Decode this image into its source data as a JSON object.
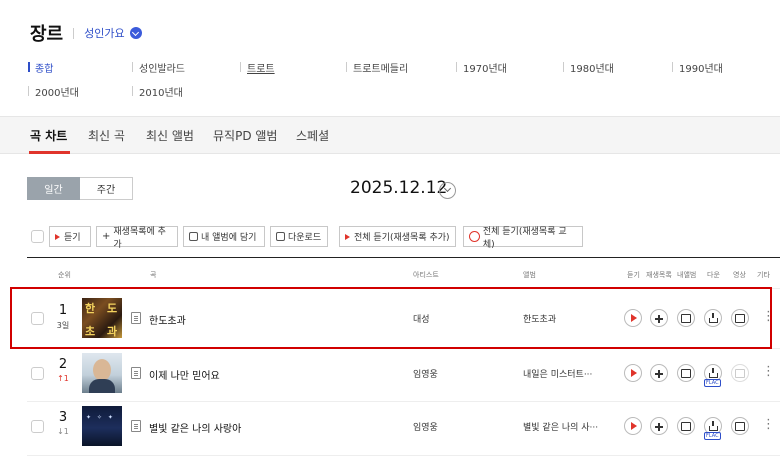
{
  "header": {
    "title": "장르",
    "subgenre": "성인가요"
  },
  "categories": [
    {
      "label": "종합",
      "active": true
    },
    {
      "label": "성인발라드"
    },
    {
      "label": "트로트"
    },
    {
      "label": "트로트메들리"
    },
    {
      "label": "1970년대"
    },
    {
      "label": "1980년대"
    },
    {
      "label": "1990년대"
    },
    {
      "label": "2000년대"
    },
    {
      "label": "2010년대"
    }
  ],
  "tabs": [
    {
      "label": "곡 차트",
      "active": true
    },
    {
      "label": "최신 곡"
    },
    {
      "label": "최신 앨범"
    },
    {
      "label": "뮤직PD 앨범"
    },
    {
      "label": "스페셜"
    }
  ],
  "period": {
    "daily": "일간",
    "weekly": "주간"
  },
  "date": "2025.12.12",
  "actions": {
    "listen": "듣기",
    "add_playlist": "재생목록에 추가",
    "add_my_album": "내 앨범에 담기",
    "download": "다운로드",
    "listen_all_add": "전체 듣기(재생목록 추가)",
    "listen_all_replace": "전체 듣기(재생목록 교체)"
  },
  "columns": {
    "rank": "순위",
    "song": "곡",
    "artist": "아티스트",
    "album": "앨범",
    "listen": "듣기",
    "playlist": "재생목록",
    "my_album": "내앨범",
    "download": "다운",
    "video": "영상",
    "etc": "기타"
  },
  "rows": [
    {
      "rank": "1",
      "change": "3일",
      "title": "한도초과",
      "artist": "대성",
      "album": "한도초과",
      "flac": false,
      "video": true
    },
    {
      "rank": "2",
      "change": "↑1",
      "title": "이제 나만 믿어요",
      "artist": "임영웅",
      "album": "내일은 미스터트···",
      "flac": true,
      "video": false
    },
    {
      "rank": "3",
      "change": "↓1",
      "title": "별빛 같은 나의 사랑아",
      "artist": "임영웅",
      "album": "별빛 같은 나의 사···",
      "flac": true,
      "video": true
    }
  ],
  "icons": [
    "check-circle-icon",
    "calendar-dropdown-icon",
    "play-icon",
    "plus-icon",
    "album-add-icon",
    "download-icon",
    "video-icon",
    "more-icon",
    "lyrics-doc-icon"
  ],
  "colors": {
    "accent_red": "#e0342b",
    "accent_blue": "#2e4ec8",
    "highlight_red": "#d10000"
  }
}
